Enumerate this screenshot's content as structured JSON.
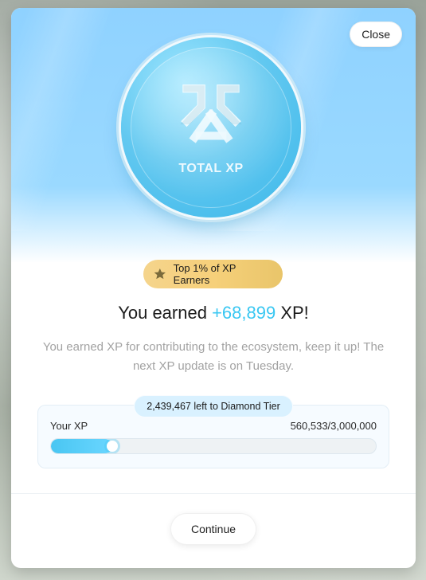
{
  "modal": {
    "close_label": "Close",
    "coin": {
      "label": "TOTAL XP",
      "icon": "xp-logo-icon"
    },
    "rank_badge": {
      "icon": "star-icon",
      "text": "Top 1% of XP Earners"
    },
    "headline": {
      "prefix": "You earned ",
      "xp_amount": "+68,899",
      "suffix": " XP!"
    },
    "description": "You earned XP for contributing to the ecosystem, keep it up! The next XP update is on Tuesday.",
    "xp_progress": {
      "tier_text": "2,439,467 left to Diamond Tier",
      "label": "Your XP",
      "value_text": "560,533/3,000,000",
      "fraction": 0.1868
    },
    "continue_label": "Continue",
    "colors": {
      "accent": "#39c7f2",
      "gold": "#f5d48c",
      "muted_text": "#a2a2a2"
    }
  }
}
